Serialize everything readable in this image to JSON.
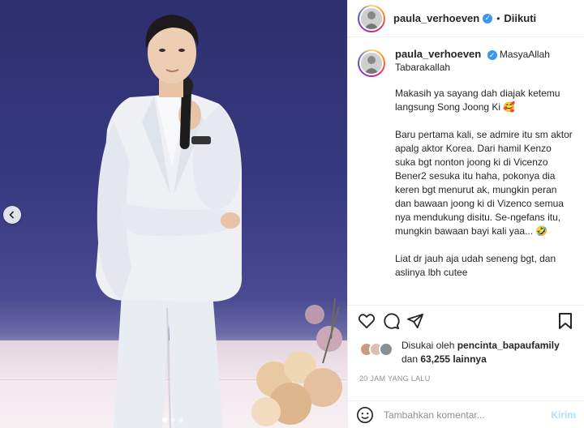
{
  "post": {
    "carousel_dots": 3,
    "active_dot": 0
  },
  "header": {
    "username": "paula_verhoeven",
    "separator": "•",
    "follow_status": "Diikuti"
  },
  "caption": {
    "username": "paula_verhoeven",
    "first_line": "MasyaAllah Tabarakallah",
    "paragraphs": [
      "Makasih ya sayang dah diajak ketemu langsung Song Joong Ki 🥰",
      "Baru pertama kali, se admire itu sm aktor apalg aktor Korea. Dari hamil Kenzo suka bgt nonton joong ki di Vicenzo\nBener2 sesuka itu haha, pokonya dia keren bgt menurut ak, mungkin peran dan bawaan joong ki di Vizenco semua nya mendukung disitu. Se-ngefans itu, mungkin bawaan bayi kali yaa... 🤣",
      "Liat dr jauh aja udah seneng bgt, dan aslinya lbh cutee"
    ]
  },
  "likes": {
    "prefix": "Disukai oleh",
    "user": "pencinta_bapaufamily",
    "connector": "dan",
    "count": "63,255",
    "suffix": "lainnya"
  },
  "timestamp": "20 JAM YANG LALU",
  "comment": {
    "placeholder": "Tambahkan komentar...",
    "post_label": "Kirim"
  },
  "colors": {
    "verified": "#3897f0",
    "post_button_disabled": "#b3dbff",
    "muted": "#8e8e8e"
  }
}
